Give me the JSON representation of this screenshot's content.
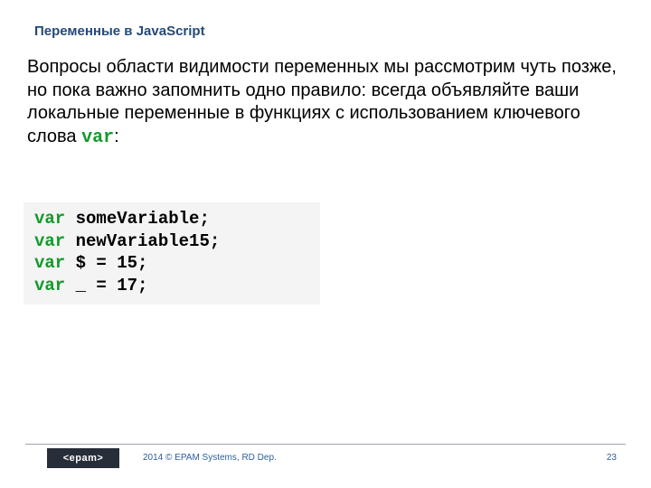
{
  "title": "Переменные в JavaScript",
  "paragraph": {
    "pre": "Вопросы области видимости переменных мы рассмотрим чуть позже, но пока важно запомнить одно правило: всегда объявляйте ваши локальные переменные в функциях с использованием ключевого слова ",
    "kw": "var",
    "post": ":"
  },
  "code": {
    "lines": [
      {
        "kw": "var",
        "rest": " someVariable;"
      },
      {
        "kw": "var",
        "rest": " newVariable15;"
      },
      {
        "kw": "var",
        "rest": " $ = 15;"
      },
      {
        "kw": "var",
        "rest": " _ = 17;"
      }
    ]
  },
  "footer": {
    "logo": "<epam>",
    "copyright": "2014 © EPAM Systems, RD Dep.",
    "page": "23"
  }
}
